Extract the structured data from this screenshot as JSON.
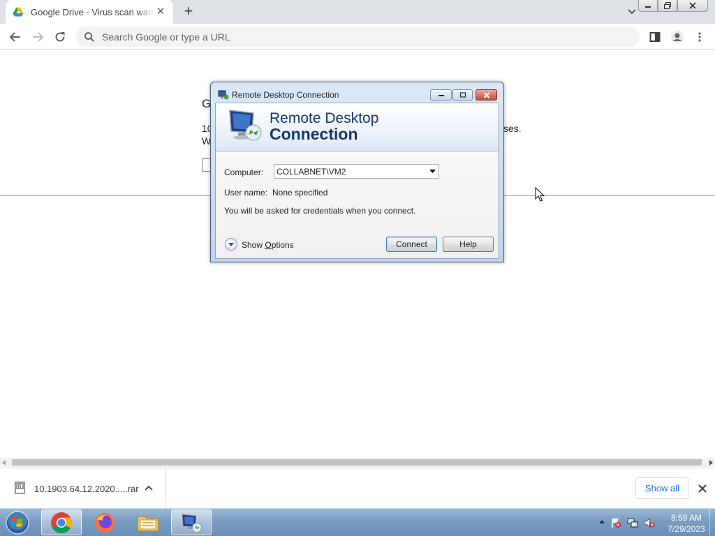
{
  "browser": {
    "tab": {
      "title": "Google Drive - Virus scan warning",
      "icon": "google-drive-icon"
    },
    "omnibox": {
      "placeholder": "Search Google or type a URL"
    }
  },
  "page": {
    "fragments": {
      "heading_start": "G",
      "line1_start": "10",
      "line1_end": "ses.",
      "line2_start": "W"
    }
  },
  "rdp_dialog": {
    "window_title": "Remote Desktop Connection",
    "banner": {
      "line1": "Remote Desktop",
      "line2": "Connection"
    },
    "computer_label": "Computer:",
    "computer_value": "COLLABNET\\VM2",
    "username_label": "User name:",
    "username_value": "None specified",
    "info_text": "You will be asked for credentials when you connect.",
    "show_options_prefix": "Show ",
    "show_options_accel": "O",
    "show_options_suffix": "ptions",
    "connect_label": "Connect",
    "help_label": "Help"
  },
  "downloads": {
    "file_name": "10.1903.64.12.2020.....rar",
    "show_all_label": "Show all"
  },
  "taskbar": {
    "items": [
      "chrome-icon",
      "firefox-icon",
      "file-explorer-icon",
      "remote-desktop-icon"
    ],
    "clock": {
      "time": "8:59 AM",
      "date": "7/29/2023"
    }
  },
  "colors": {
    "accent_blue": "#1a73e8",
    "rdp_banner_text": "#16366a",
    "taskbar": "#7a9cc1"
  }
}
